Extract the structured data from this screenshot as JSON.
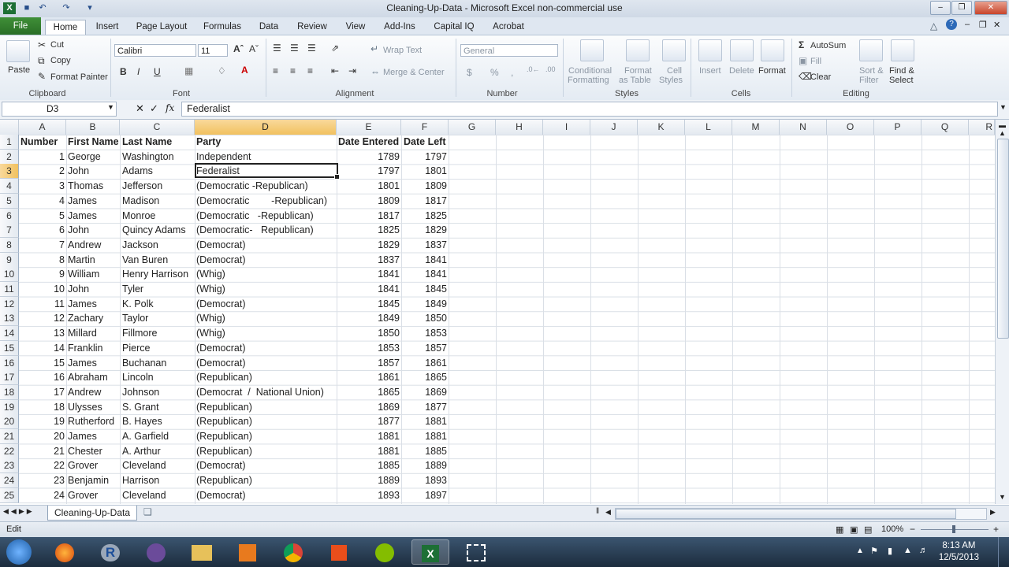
{
  "window": {
    "title": "Cleaning-Up-Data  -  Microsoft Excel non-commercial use",
    "controls": [
      "minimize",
      "restore",
      "close"
    ]
  },
  "qat": {
    "icons": [
      "excel-logo-icon",
      "save-icon",
      "undo-icon",
      "redo-icon",
      "qat-customize-icon"
    ]
  },
  "ribbon_tabs": [
    "File",
    "Home",
    "Insert",
    "Page Layout",
    "Formulas",
    "Data",
    "Review",
    "View",
    "Add-Ins",
    "Capital IQ",
    "Acrobat"
  ],
  "active_tab": "Home",
  "ribbon": {
    "clipboard": {
      "paste": "Paste",
      "cut": "Cut",
      "copy": "Copy",
      "format_painter": "Format Painter",
      "label": "Clipboard"
    },
    "font": {
      "name": "Calibri",
      "size": "11",
      "bold": "B",
      "italic": "I",
      "underline": "U",
      "label": "Font"
    },
    "alignment": {
      "wrap_text": "Wrap Text",
      "merge_center": "Merge & Center",
      "label": "Alignment"
    },
    "number": {
      "format": "General",
      "currency": "$",
      "percent": "%",
      "comma": ",",
      "label": "Number"
    },
    "styles": {
      "conditional": "Conditional",
      "conditional2": "Formatting",
      "format_as": "Format",
      "format_as2": "as Table",
      "cell": "Cell",
      "cell2": "Styles",
      "label": "Styles"
    },
    "cells": {
      "insert": "Insert",
      "delete": "Delete",
      "format": "Format",
      "label": "Cells"
    },
    "editing": {
      "autosum": "AutoSum",
      "fill": "Fill",
      "clear": "Clear",
      "sort": "Sort &",
      "sort2": "Filter",
      "find": "Find &",
      "find2": "Select",
      "label": "Editing"
    }
  },
  "formula_bar": {
    "name_box": "D3",
    "fx": "fx",
    "value": "Federalist"
  },
  "columns": [
    "A",
    "B",
    "C",
    "D",
    "E",
    "F",
    "G",
    "H",
    "I",
    "J",
    "K",
    "L",
    "M",
    "N",
    "O",
    "P",
    "Q",
    "R"
  ],
  "selected_column": "D",
  "selected_row": "3",
  "row_numbers": [
    "1",
    "2",
    "3",
    "4",
    "5",
    "6",
    "7",
    "8",
    "9",
    "10",
    "11",
    "12",
    "13",
    "14",
    "15",
    "16",
    "17",
    "18",
    "19",
    "20",
    "21",
    "22",
    "23",
    "24",
    "25"
  ],
  "headers": [
    "Number",
    "First Name",
    "Last Name",
    "Party",
    "Date Entered",
    "Date Left"
  ],
  "rows": [
    [
      "1",
      "George",
      "Washington",
      "Independent",
      "1789",
      "1797"
    ],
    [
      "2",
      "John",
      "Adams",
      "Federalist",
      "1797",
      "1801"
    ],
    [
      "3",
      "Thomas",
      "Jefferson",
      "(Democratic -Republican)",
      "1801",
      "1809"
    ],
    [
      "4",
      "James",
      "Madison",
      "(Democratic        -Republican)",
      "1809",
      "1817"
    ],
    [
      "5",
      "James",
      "Monroe",
      "(Democratic   -Republican)",
      "1817",
      "1825"
    ],
    [
      "6",
      "John",
      "Quincy Adams",
      "(Democratic-   Republican)",
      "1825",
      "1829"
    ],
    [
      "7",
      "Andrew",
      "Jackson",
      "(Democrat)",
      "1829",
      "1837"
    ],
    [
      "8",
      "Martin",
      "Van Buren",
      "(Democrat)",
      "1837",
      "1841"
    ],
    [
      "9",
      "William",
      "Henry Harrison",
      "(Whig)",
      "1841",
      "1841"
    ],
    [
      "10",
      "John",
      "Tyler",
      "(Whig)",
      "1841",
      "1845"
    ],
    [
      "11",
      "James",
      "K. Polk",
      "(Democrat)",
      "1845",
      "1849"
    ],
    [
      "12",
      "Zachary",
      "Taylor",
      "(Whig)",
      "1849",
      "1850"
    ],
    [
      "13",
      "Millard",
      "Fillmore",
      "(Whig)",
      "1850",
      "1853"
    ],
    [
      "14",
      "Franklin",
      "Pierce",
      "(Democrat)",
      "1853",
      "1857"
    ],
    [
      "15",
      "James",
      "Buchanan",
      "(Democrat)",
      "1857",
      "1861"
    ],
    [
      "16",
      "Abraham",
      "Lincoln",
      "(Republican)",
      "1861",
      "1865"
    ],
    [
      "17",
      "Andrew",
      "Johnson",
      "(Democrat  /  National Union)",
      "1865",
      "1869"
    ],
    [
      "18",
      "Ulysses",
      "S. Grant",
      "(Republican)",
      "1869",
      "1877"
    ],
    [
      "19",
      "Rutherford",
      "B. Hayes",
      "(Republican)",
      "1877",
      "1881"
    ],
    [
      "20",
      "James",
      "A. Garfield",
      "(Republican)",
      "1881",
      "1881"
    ],
    [
      "21",
      "Chester",
      "A. Arthur",
      "(Republican)",
      "1881",
      "1885"
    ],
    [
      "22",
      "Grover",
      "Cleveland",
      "(Democrat)",
      "1885",
      "1889"
    ],
    [
      "23",
      "Benjamin",
      "Harrison",
      "(Republican)",
      "1889",
      "1893"
    ],
    [
      "24",
      "Grover",
      "Cleveland",
      "(Democrat)",
      "1893",
      "1897"
    ]
  ],
  "sheet_tab": "Cleaning-Up-Data",
  "status": {
    "mode": "Edit",
    "zoom": "100%"
  },
  "taskbar": {
    "apps": [
      "firefox-icon",
      "r-icon",
      "app-icon",
      "explorer-icon",
      "media-player-icon",
      "chrome-icon",
      "apps-grid-icon",
      "spotify-icon",
      "excel-icon",
      "snipping-tool-icon"
    ],
    "time": "8:13 AM",
    "date": "12/5/2013"
  }
}
